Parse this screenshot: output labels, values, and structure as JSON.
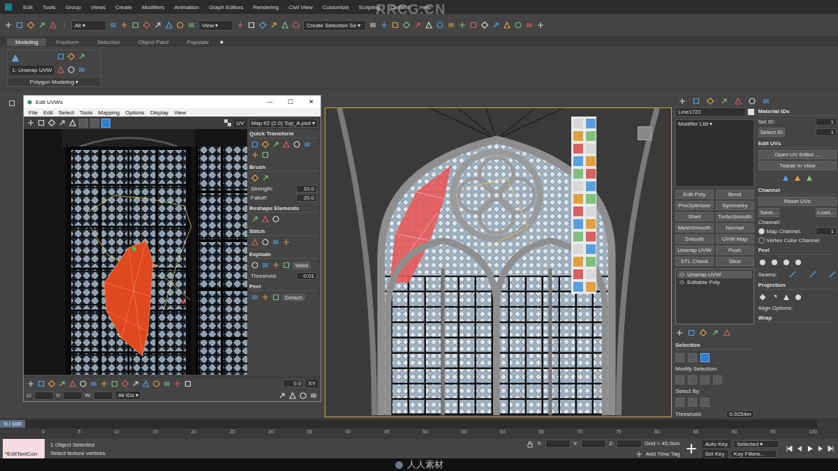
{
  "watermarks": [
    "RRCG.CN",
    "人人素材"
  ],
  "menu_bar": [
    "Edit",
    "Tools",
    "Group",
    "Views",
    "Create",
    "Modifiers",
    "Animation",
    "Graph Editors",
    "Rendering",
    "Civil View",
    "Customize",
    "Scripting",
    "Content",
    "Help"
  ],
  "toolbar": {
    "filter": "All",
    "view": "View",
    "selection_set": "Create Selection Se"
  },
  "ribbon": {
    "tabs": [
      {
        "label": "Modeling",
        "selected": true
      },
      {
        "label": "Freeform",
        "selected": false
      },
      {
        "label": "Selection",
        "selected": false
      },
      {
        "label": "Object Paint",
        "selected": false
      },
      {
        "label": "Populate",
        "selected": false
      }
    ],
    "stack_field": "1: Unwrap UVW",
    "panel_label": "Polygon Modeling ▾"
  },
  "uv_editor": {
    "title": "Edit UVWs",
    "controls": [
      "—",
      "☐",
      "✕"
    ],
    "menu": [
      "File",
      "Edit",
      "Select",
      "Tools",
      "Mapping",
      "Options",
      "Display",
      "View"
    ],
    "uv_label": "UV",
    "map": "Map #2 (2.0)  Top_A.psd",
    "selection_modes": [
      {
        "selected": false
      },
      {
        "selected": false
      },
      {
        "selected": true
      }
    ],
    "sections": [
      {
        "title": "Quick Transform",
        "buttons": [],
        "fields": []
      },
      {
        "title": "Brush",
        "buttons": [],
        "fields": [
          {
            "label": "Strength:",
            "value": "10.0"
          },
          {
            "label": "Falloff:",
            "value": "20.0"
          }
        ]
      },
      {
        "title": "Reshape Elements",
        "buttons": [],
        "fields": []
      },
      {
        "title": "Stitch",
        "buttons": [],
        "fields": []
      },
      {
        "title": "Explode",
        "buttons": [
          "Weld"
        ],
        "fields": [
          {
            "label": "Threshold:",
            "value": "0.01"
          }
        ]
      },
      {
        "title": "Peel",
        "buttons": [
          "Detach"
        ],
        "fields": []
      }
    ],
    "axes": [
      "U:",
      "V:",
      "W:"
    ],
    "xy": "XY",
    "id_filter": "All IDs",
    "spinner": "0.0"
  },
  "viewport": {
    "active": true
  },
  "command_panel": {
    "object_name": "Line1722",
    "modifier_list": "Modifier List",
    "modifier_buttons": [
      "Edit Poly",
      "Bend",
      "ProOptimizer",
      "Symmetry",
      "Shell",
      "TurboSmooth",
      "MeshSmooth",
      "Normal",
      "Smooth",
      "UVW Map",
      "Unwrap UVW",
      "Push",
      "STL Check",
      "Slice"
    ],
    "stack": [
      {
        "label": "Unwrap UVW",
        "selected": true
      },
      {
        "label": "Editable Poly",
        "selected": false
      }
    ],
    "selection": {
      "title": "Selection",
      "modes": [
        {
          "selected": false
        },
        {
          "selected": false
        },
        {
          "selected": true
        }
      ],
      "modify_label": "Modify Selection:",
      "select_by": "Select By:",
      "threshold_label": "Threshold:",
      "threshold": "0.0254m"
    },
    "material_ids": {
      "title": "Material IDs",
      "set_id": "Set ID:",
      "set_id_value": "1",
      "select_id": "Select ID",
      "select_id_value": "1"
    },
    "edit_uvs": {
      "title": "Edit UVs",
      "buttons": [
        "Open UV Editor ...",
        "Tweak In View"
      ]
    },
    "channel": {
      "title": "Channel",
      "buttons": [
        "Reset UVs",
        "Save...",
        "Load..."
      ],
      "label": "Channel:",
      "options": [
        {
          "label": "Map Channel:",
          "selected": true,
          "value": "1"
        },
        {
          "label": "Vertex Color Channel",
          "selected": false,
          "value": ""
        }
      ]
    },
    "peel": {
      "title": "Peel",
      "seams": "Seams:"
    },
    "projection": {
      "title": "Projection",
      "align": "Align Options:"
    },
    "wrap": {
      "title": "Wrap"
    }
  },
  "timeline": {
    "position": "0 / 100",
    "level": 0,
    "ticks": [
      "0",
      "5",
      "10",
      "15",
      "20",
      "25",
      "30",
      "35",
      "40",
      "45",
      "50",
      "55",
      "60",
      "65",
      "70",
      "75",
      "80",
      "85",
      "90",
      "95",
      "100"
    ]
  },
  "status_bar": {
    "script": "*EditTextCon",
    "selected": "1 Object Selected",
    "prompt": "Select texture vertices",
    "coords": [
      "X:",
      "Y:",
      "Z:"
    ],
    "grid": "Grid = 45.0cm",
    "time_tag": "Add Time Tag",
    "auto_key": "Auto Key",
    "key_mode": "Selected",
    "set_key": "Set Key",
    "key_filters": "Key Filters..."
  }
}
